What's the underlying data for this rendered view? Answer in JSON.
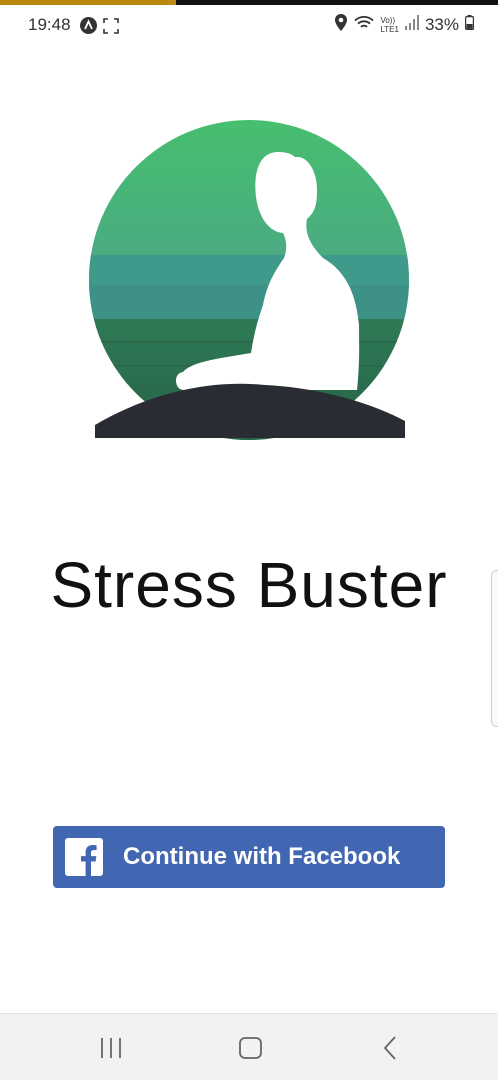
{
  "status_bar": {
    "time": "19:48",
    "battery": "33%",
    "icons": [
      "app-notification-icon",
      "screenshot-icon",
      "location-icon",
      "wifi-icon",
      "volte-icon",
      "signal-icon",
      "battery-icon"
    ],
    "volte_top": "Vo))",
    "volte_bottom": "LTE1"
  },
  "app": {
    "title": "Stress Buster",
    "logo_icon": "meditation-logo-icon"
  },
  "login": {
    "facebook_label": "Continue with Facebook",
    "facebook_color": "#4267b2"
  },
  "nav_bar": {
    "recents": "recents-icon",
    "home": "home-icon",
    "back": "back-icon"
  }
}
